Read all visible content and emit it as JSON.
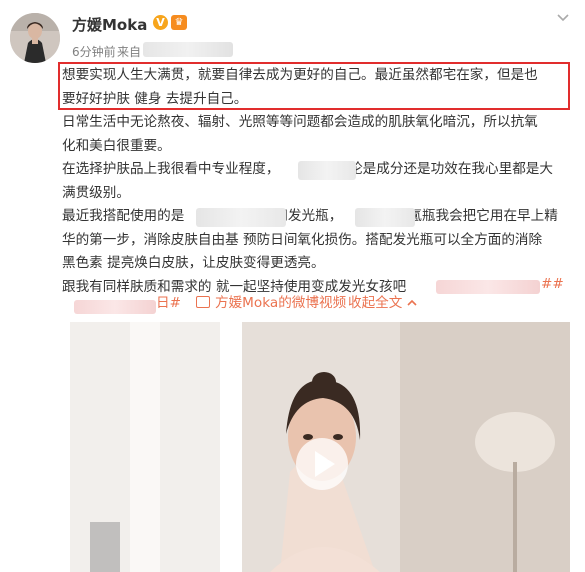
{
  "header": {
    "username": "方媛Moka",
    "verified_icon": "verified-badge-icon",
    "vip_icon": "vip-crown-icon",
    "time": "6分钟前",
    "source_prefix": "来自",
    "more_icon": "chevron-down-icon"
  },
  "post": {
    "lines": [
      "想要实现人生大满贯，就要自律去成为更好的自己。最近虽然都宅在家，但是也",
      "要好好护肤 健身 去提升自己。",
      "日常生活中无论熬夜、辐射、光照等等问题都会造成的肌肤氧化暗沉，所以抗氧",
      "化和美白很重要。",
      "在选择护肤品上我很看中专业程度，",
      "无论是成分还是功效在我心里都是大",
      "满贯级别。",
      "最近我搭配使用的是",
      "和发光瓶，",
      "氲瓶我会把它用在早上精",
      "华的第一步，消除皮肤自由基 预防日间氧化损伤。搭配发光瓶可以全方面的消除",
      "黑色素 提亮焕白皮肤，让皮肤变得更透亮。",
      "跟我有同样肤质和需求的 就一起坚持使用变成发光女孩吧"
    ],
    "hashtag_tail_1": "##",
    "hashtag_tail_2": "日#",
    "video_link": "方媛Moka的微博视频",
    "expand_link": "收起全文",
    "expand_icon": "chevron-up-icon",
    "video_play_icon": "play-icon"
  },
  "colors": {
    "highlight_border": "#e12d2d",
    "link": "#eb7350",
    "text": "#333333",
    "meta": "#808080"
  }
}
